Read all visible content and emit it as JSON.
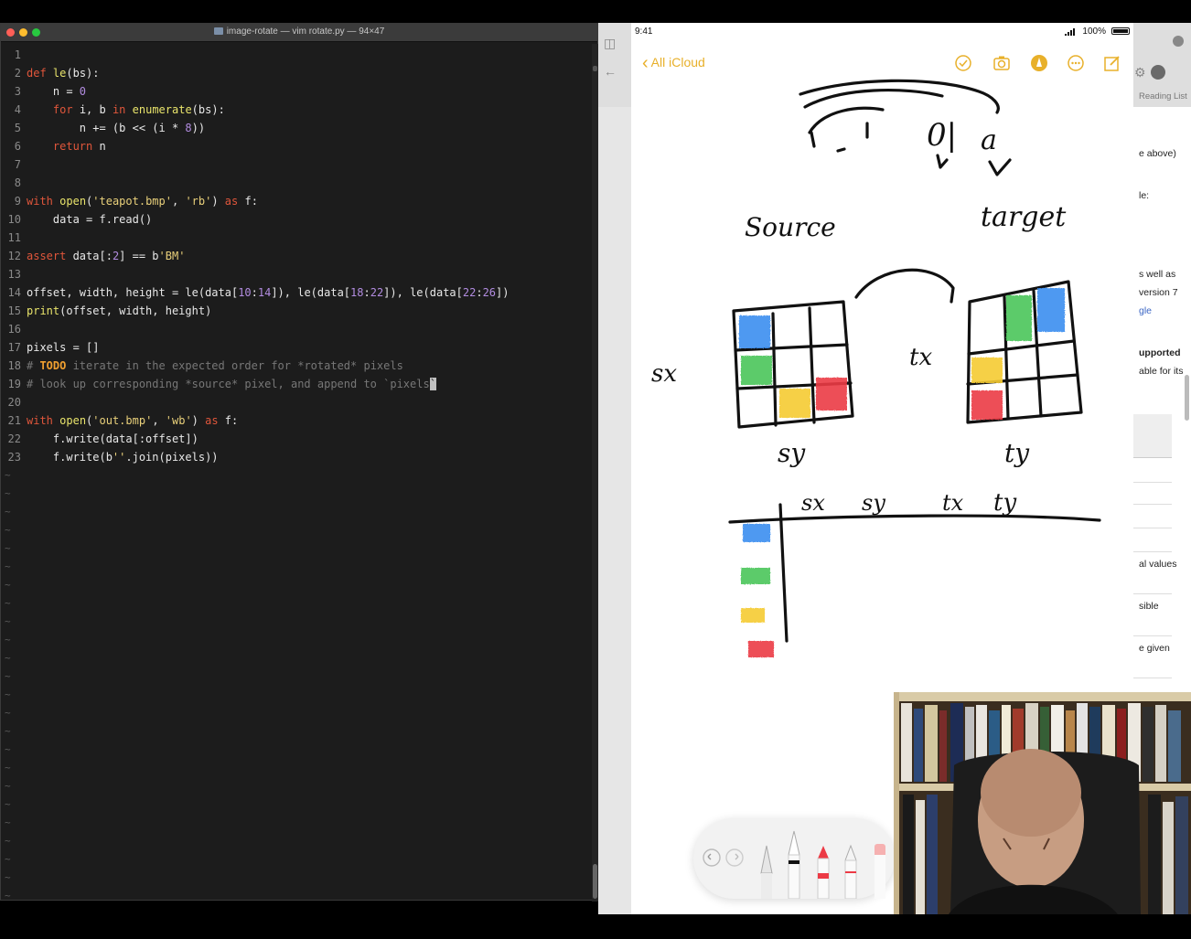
{
  "terminal": {
    "window_title": "image-rotate — vim rotate.py — 94×47",
    "lines": [
      {
        "n": "1"
      },
      {
        "n": "2",
        "parts": [
          [
            "k",
            "def"
          ],
          [
            "p",
            " "
          ],
          [
            "f",
            "le"
          ],
          [
            "p",
            "(bs):"
          ]
        ]
      },
      {
        "n": "3",
        "parts": [
          [
            "p",
            "    n = "
          ],
          [
            "n",
            "0"
          ]
        ]
      },
      {
        "n": "4",
        "parts": [
          [
            "p",
            "    "
          ],
          [
            "k",
            "for"
          ],
          [
            "p",
            " i, b "
          ],
          [
            "k",
            "in"
          ],
          [
            "p",
            " "
          ],
          [
            "f",
            "enumerate"
          ],
          [
            "p",
            "(bs):"
          ]
        ]
      },
      {
        "n": "5",
        "parts": [
          [
            "p",
            "        n += (b << (i * "
          ],
          [
            "n",
            "8"
          ],
          [
            "p",
            "))"
          ]
        ]
      },
      {
        "n": "6",
        "parts": [
          [
            "p",
            "    "
          ],
          [
            "k",
            "return"
          ],
          [
            "p",
            " n"
          ]
        ]
      },
      {
        "n": "7"
      },
      {
        "n": "8"
      },
      {
        "n": "9",
        "parts": [
          [
            "k",
            "with"
          ],
          [
            "p",
            " "
          ],
          [
            "f",
            "open"
          ],
          [
            "p",
            "("
          ],
          [
            "s",
            "'teapot.bmp'"
          ],
          [
            "p",
            ", "
          ],
          [
            "s",
            "'rb'"
          ],
          [
            "p",
            ") "
          ],
          [
            "k",
            "as"
          ],
          [
            "p",
            " f:"
          ]
        ]
      },
      {
        "n": "10",
        "parts": [
          [
            "p",
            "    data = f.read()"
          ]
        ]
      },
      {
        "n": "11"
      },
      {
        "n": "12",
        "parts": [
          [
            "k",
            "assert"
          ],
          [
            "p",
            " data[:"
          ],
          [
            "n",
            "2"
          ],
          [
            "p",
            "] == b"
          ],
          [
            "s",
            "'BM'"
          ]
        ]
      },
      {
        "n": "13"
      },
      {
        "n": "14",
        "parts": [
          [
            "p",
            "offset, width, height = le(data["
          ],
          [
            "n",
            "10"
          ],
          [
            "p",
            ":"
          ],
          [
            "n",
            "14"
          ],
          [
            "p",
            "]), le(data["
          ],
          [
            "n",
            "18"
          ],
          [
            "p",
            ":"
          ],
          [
            "n",
            "22"
          ],
          [
            "p",
            "]), le(data["
          ],
          [
            "n",
            "22"
          ],
          [
            "p",
            ":"
          ],
          [
            "n",
            "26"
          ],
          [
            "p",
            "])"
          ]
        ]
      },
      {
        "n": "15",
        "parts": [
          [
            "f",
            "print"
          ],
          [
            "p",
            "(offset, width, height)"
          ]
        ]
      },
      {
        "n": "16"
      },
      {
        "n": "17",
        "parts": [
          [
            "p",
            "pixels = []"
          ]
        ]
      },
      {
        "n": "18",
        "parts": [
          [
            "c",
            "# "
          ],
          [
            "todo",
            "TODO"
          ],
          [
            "c",
            " iterate in the expected order for *rotated* pixels"
          ]
        ]
      },
      {
        "n": "19",
        "parts": [
          [
            "c",
            "# look up corresponding *source* pixel, and append to `pixels"
          ],
          [
            "cursor",
            "`"
          ]
        ]
      },
      {
        "n": "20"
      },
      {
        "n": "21",
        "parts": [
          [
            "k",
            "with"
          ],
          [
            "p",
            " "
          ],
          [
            "f",
            "open"
          ],
          [
            "p",
            "("
          ],
          [
            "s",
            "'out.bmp'"
          ],
          [
            "p",
            ", "
          ],
          [
            "s",
            "'wb'"
          ],
          [
            "p",
            ") "
          ],
          [
            "k",
            "as"
          ],
          [
            "p",
            " f:"
          ]
        ]
      },
      {
        "n": "22",
        "parts": [
          [
            "p",
            "    f.write(data[:offset])"
          ]
        ]
      },
      {
        "n": "23",
        "parts": [
          [
            "p",
            "    f.write(b"
          ],
          [
            "s",
            "''"
          ],
          [
            "p",
            ".join(pixels))"
          ]
        ]
      }
    ],
    "tilde": "~"
  },
  "browser": {
    "reading_list": "Reading List",
    "fragments": [
      "e above)",
      "le:",
      "s well as",
      "version 7",
      "gle",
      "upported",
      "able for its",
      "al values",
      "sible",
      "e given"
    ]
  },
  "notes": {
    "status_time": "9:41",
    "status_battery": "100%",
    "back_label": "All iCloud",
    "handwriting": {
      "top_left": "0|",
      "top_right": "a",
      "source": "Source",
      "target": "target",
      "sx": "sx",
      "sy": "sy",
      "tx": "tx",
      "ty": "ty",
      "col_sx": "sx",
      "col_sy": "sy",
      "col_tx": "tx",
      "col_ty": "ty"
    },
    "colors": {
      "blue": "#3a8ef0",
      "green": "#4cc65a",
      "yellow": "#f6cc33",
      "red": "#ec3a45",
      "ink": "#111111",
      "accent": "#e8b02a"
    },
    "icons": [
      "checkmark-circle-icon",
      "camera-icon",
      "markup-icon",
      "more-icon",
      "compose-icon",
      "undo-icon",
      "redo-icon",
      "pen-icon",
      "marker-icon",
      "pencil-icon",
      "eraser-icon"
    ]
  }
}
